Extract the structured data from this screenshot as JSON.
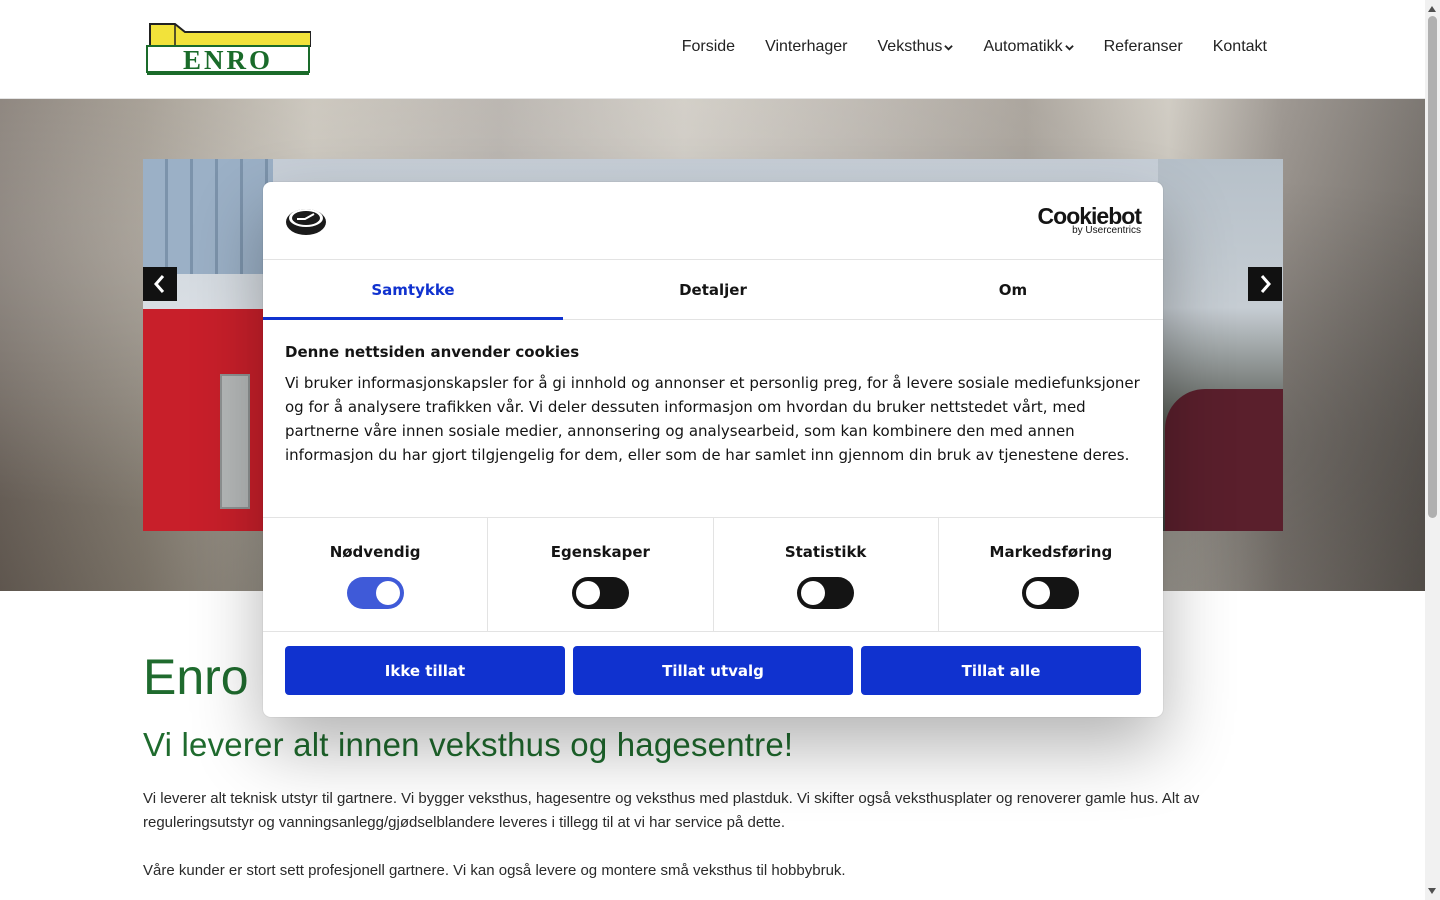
{
  "nav": {
    "items": [
      {
        "label": "Forside",
        "dropdown": false
      },
      {
        "label": "Vinterhager",
        "dropdown": false
      },
      {
        "label": "Veksthus",
        "dropdown": true
      },
      {
        "label": "Automatikk",
        "dropdown": true
      },
      {
        "label": "Referanser",
        "dropdown": false
      },
      {
        "label": "Kontakt",
        "dropdown": false
      }
    ]
  },
  "logo": {
    "text": "ENRO",
    "colors": {
      "roof": "#f2e23a",
      "text": "#1a6b2a"
    }
  },
  "hero": {
    "slider_icons": {
      "prev": "chevron-left-icon",
      "next": "chevron-right-icon"
    }
  },
  "content": {
    "heading": "Enro",
    "subheading": "Vi leverer alt innen veksthus og hagesentre!",
    "paragraph1": "Vi leverer alt teknisk utstyr til gartnere. Vi bygger veksthus, hagesentre og veksthus med plastduk. Vi skifter også veksthusplater og renoverer gamle hus. Alt av reguleringsutstyr og vanningsanlegg/gjødselblandere leveres i tillegg til at vi har service på dette.",
    "paragraph2": "Våre kunder er stort sett profesjonell gartnere. Vi kan også levere og montere små veksthus til hobbybruk."
  },
  "cookie": {
    "brand": "Cookiebot",
    "brand_sub": "by Usercentrics",
    "tabs": [
      {
        "label": "Samtykke",
        "active": true
      },
      {
        "label": "Detaljer",
        "active": false
      },
      {
        "label": "Om",
        "active": false
      }
    ],
    "title": "Denne nettsiden anvender cookies",
    "text": "Vi bruker informasjonskapsler for å gi innhold og annonser et personlig preg, for å levere sosiale mediefunksjoner og for å analysere trafikken vår. Vi deler dessuten informasjon om hvordan du bruker nettstedet vårt, med partnerne våre innen sosiale medier, annonsering og analysearbeid, som kan kombinere den med annen informasjon du har gjort tilgjengelig for dem, eller som de har samlet inn gjennom din bruk av tjenestene deres.",
    "toggles": [
      {
        "label": "Nødvendig",
        "on": true
      },
      {
        "label": "Egenskaper",
        "on": false
      },
      {
        "label": "Statistikk",
        "on": false
      },
      {
        "label": "Markedsføring",
        "on": false
      }
    ],
    "buttons": {
      "deny": "Ikke tillat",
      "selection": "Tillat utvalg",
      "allow_all": "Tillat alle"
    },
    "accent": "#1032cf"
  }
}
